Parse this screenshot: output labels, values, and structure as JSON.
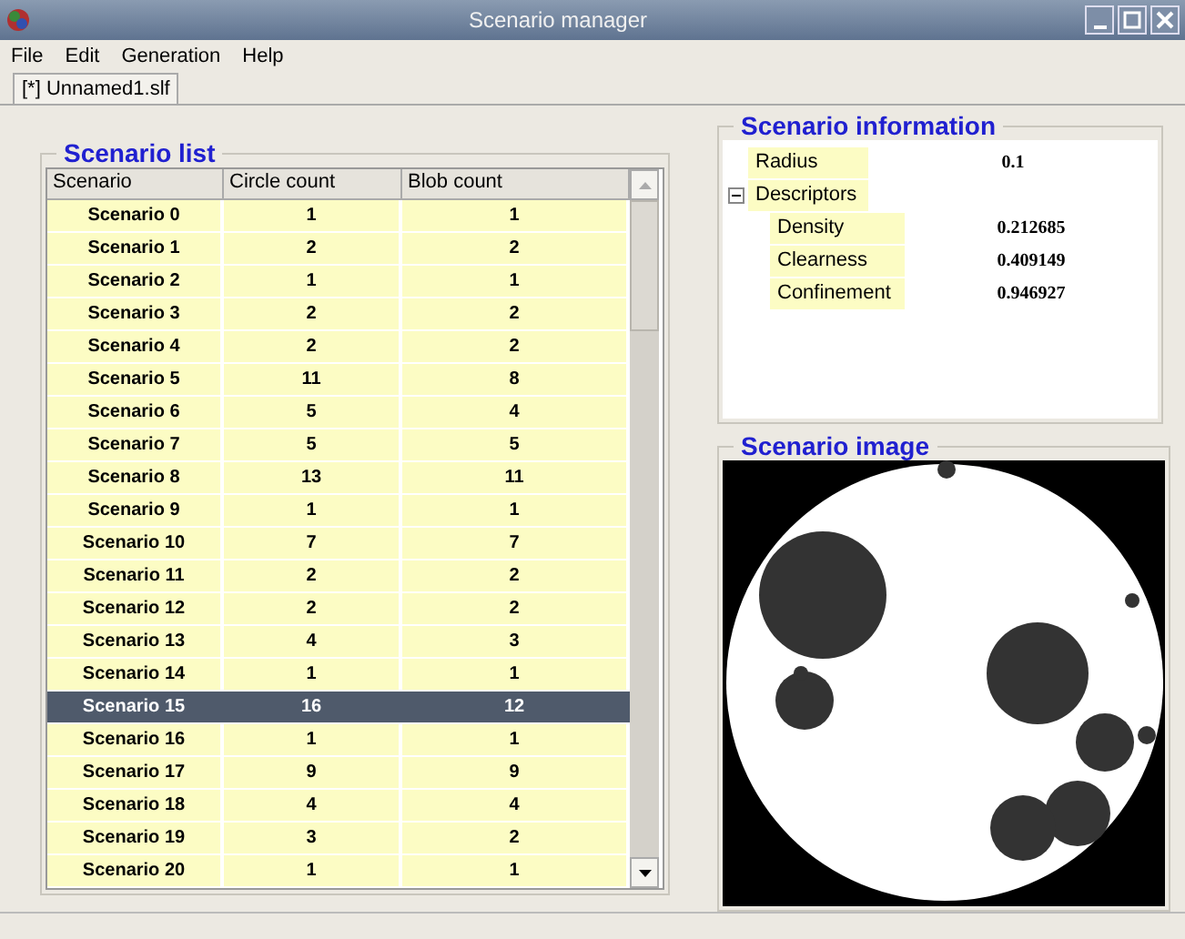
{
  "window": {
    "title": "Scenario manager"
  },
  "menu": [
    "File",
    "Edit",
    "Generation",
    "Help"
  ],
  "tabs": [
    {
      "label": "[*] Unnamed1.slf",
      "selected": true
    }
  ],
  "scenario_list": {
    "title": "Scenario list",
    "columns": [
      "Scenario",
      "Circle count",
      "Blob count"
    ],
    "rows": [
      {
        "name": "Scenario 0",
        "circles": "1",
        "blobs": "1",
        "selected": false
      },
      {
        "name": "Scenario 1",
        "circles": "2",
        "blobs": "2",
        "selected": false
      },
      {
        "name": "Scenario 2",
        "circles": "1",
        "blobs": "1",
        "selected": false
      },
      {
        "name": "Scenario 3",
        "circles": "2",
        "blobs": "2",
        "selected": false
      },
      {
        "name": "Scenario 4",
        "circles": "2",
        "blobs": "2",
        "selected": false
      },
      {
        "name": "Scenario 5",
        "circles": "11",
        "blobs": "8",
        "selected": false
      },
      {
        "name": "Scenario 6",
        "circles": "5",
        "blobs": "4",
        "selected": false
      },
      {
        "name": "Scenario 7",
        "circles": "5",
        "blobs": "5",
        "selected": false
      },
      {
        "name": "Scenario 8",
        "circles": "13",
        "blobs": "11",
        "selected": false
      },
      {
        "name": "Scenario 9",
        "circles": "1",
        "blobs": "1",
        "selected": false
      },
      {
        "name": "Scenario 10",
        "circles": "7",
        "blobs": "7",
        "selected": false
      },
      {
        "name": "Scenario 11",
        "circles": "2",
        "blobs": "2",
        "selected": false
      },
      {
        "name": "Scenario 12",
        "circles": "2",
        "blobs": "2",
        "selected": false
      },
      {
        "name": "Scenario 13",
        "circles": "4",
        "blobs": "3",
        "selected": false
      },
      {
        "name": "Scenario 14",
        "circles": "1",
        "blobs": "1",
        "selected": false
      },
      {
        "name": "Scenario 15",
        "circles": "16",
        "blobs": "12",
        "selected": true
      },
      {
        "name": "Scenario 16",
        "circles": "1",
        "blobs": "1",
        "selected": false
      },
      {
        "name": "Scenario 17",
        "circles": "9",
        "blobs": "9",
        "selected": false
      },
      {
        "name": "Scenario 18",
        "circles": "4",
        "blobs": "4",
        "selected": false
      },
      {
        "name": "Scenario 19",
        "circles": "3",
        "blobs": "2",
        "selected": false
      },
      {
        "name": "Scenario 20",
        "circles": "1",
        "blobs": "1",
        "selected": false
      }
    ]
  },
  "scenario_information": {
    "title": "Scenario information",
    "properties": [
      {
        "label": "Radius",
        "value": "0.1"
      },
      {
        "label": "Descriptors",
        "expanded": true,
        "children": [
          {
            "label": "Density",
            "value": "0.212685"
          },
          {
            "label": "Clearness",
            "value": "0.409149"
          },
          {
            "label": "Confinement",
            "value": "0.946927"
          }
        ]
      }
    ]
  },
  "scenario_image": {
    "title": "Scenario image"
  }
}
